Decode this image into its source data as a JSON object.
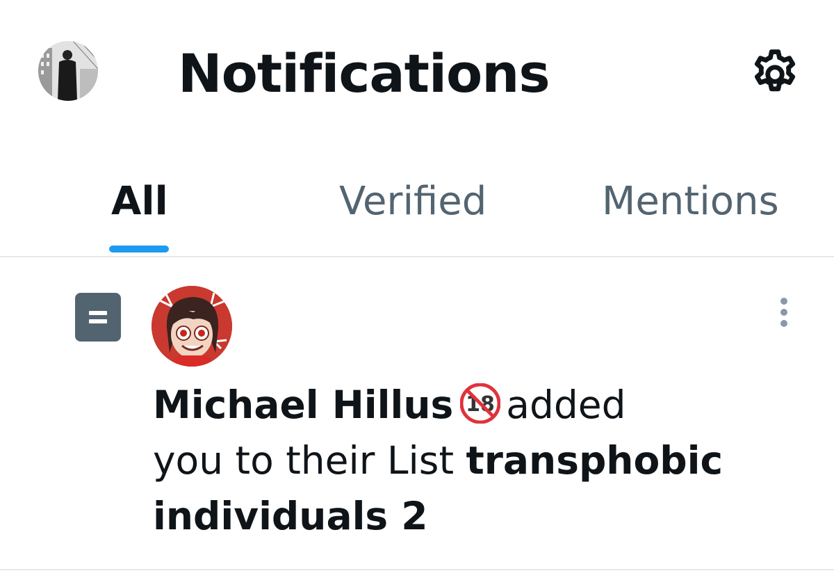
{
  "header": {
    "title": "Notifications",
    "avatar_icon": "user-avatar-icon",
    "settings_icon": "gear-icon"
  },
  "tabs": [
    {
      "label": "All",
      "active": true
    },
    {
      "label": "Verified",
      "active": false
    },
    {
      "label": "Mentions",
      "active": false
    }
  ],
  "colors": {
    "accent": "#1d9bf0",
    "text_primary": "#0f1419",
    "text_secondary": "#536471",
    "divider": "#e6e9eb"
  },
  "notification": {
    "type_icon": "list-icon",
    "actor_name": "Michael Hillus",
    "actor_badge": "no-under-18-emoji",
    "text_after_name": "added",
    "text_line2": "you to their List",
    "list_name_part1": "transphobic",
    "list_name_part2": "individuals 2",
    "more_icon": "more-vertical-icon"
  }
}
